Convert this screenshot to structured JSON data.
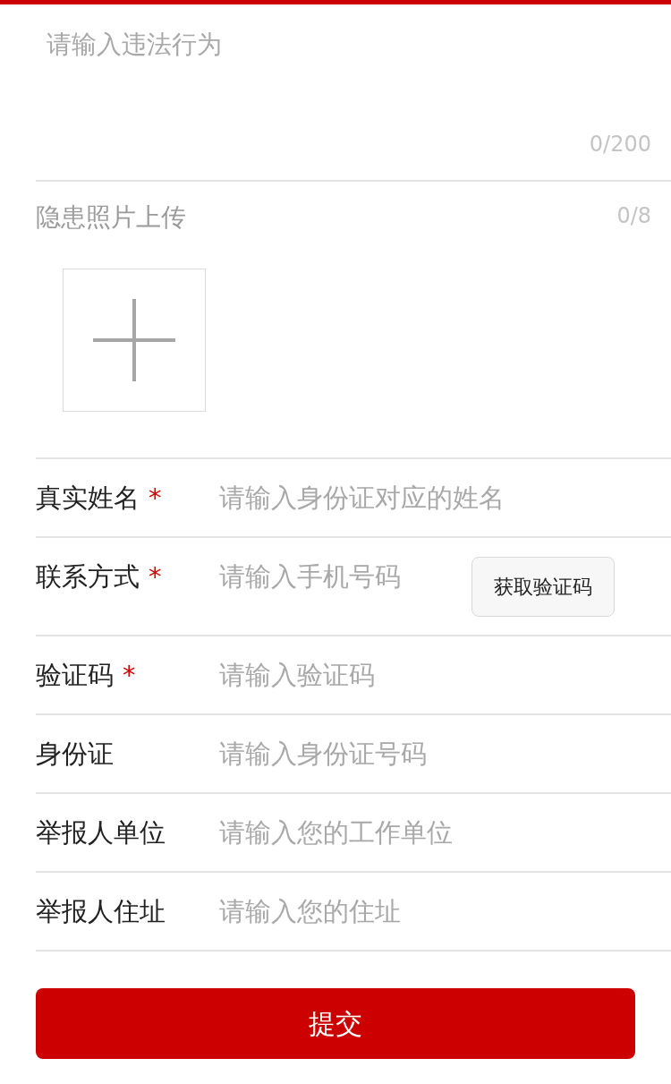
{
  "violation": {
    "placeholder": "请输入违法行为",
    "counter": "0/200"
  },
  "photos": {
    "label": "隐患照片上传",
    "counter": "0/8"
  },
  "fields": [
    {
      "kind": "text",
      "label": "真实姓名",
      "required_mark": "*",
      "placeholder": "请输入身份证对应的姓名"
    },
    {
      "kind": "code",
      "label": "联系方式",
      "required_mark": "*",
      "placeholder": "请输入手机号码",
      "button": "获取验证码"
    },
    {
      "kind": "text",
      "label": "验证码",
      "required_mark": "*",
      "placeholder": "请输入验证码"
    },
    {
      "kind": "text",
      "label": "身份证",
      "placeholder": "请输入身份证号码"
    },
    {
      "kind": "text",
      "label": "举报人单位",
      "placeholder": "请输入您的工作单位"
    },
    {
      "kind": "text",
      "label": "举报人住址",
      "placeholder": "请输入您的住址"
    }
  ],
  "submit": "提交"
}
